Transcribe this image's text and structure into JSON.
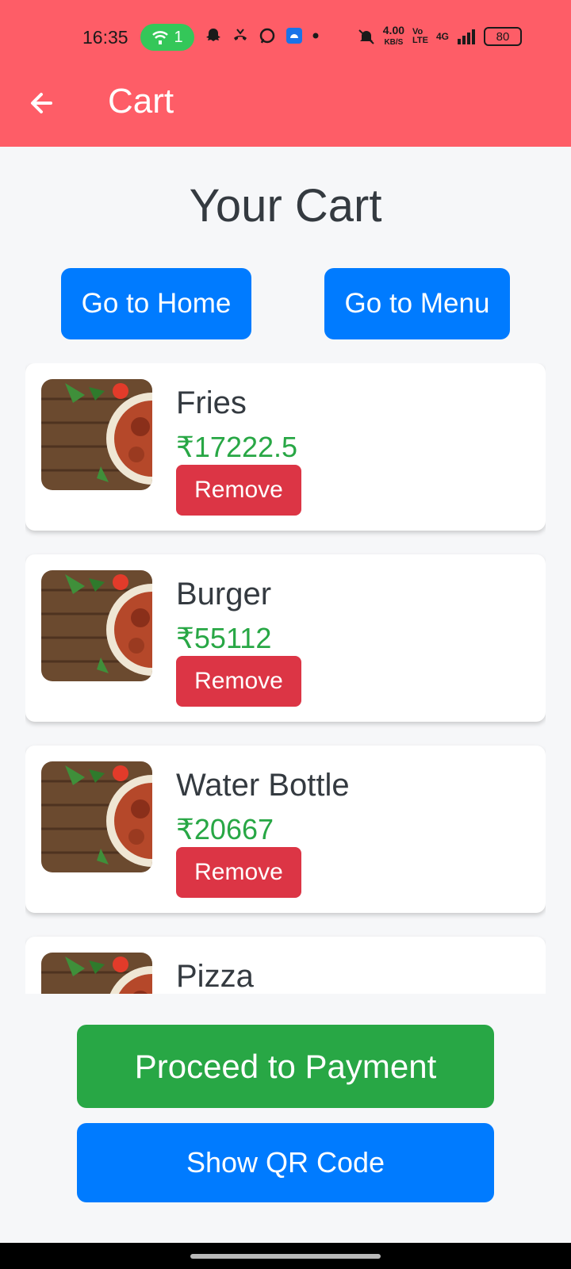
{
  "status_bar": {
    "time": "16:35",
    "wifi_badge": "1",
    "speed": "4.00",
    "speed_unit": "KB/S",
    "network": "4G",
    "battery": "80"
  },
  "app_bar": {
    "title": "Cart",
    "back_icon": "arrow-left-icon"
  },
  "page": {
    "heading": "Your Cart",
    "home_button": "Go to Home",
    "menu_button": "Go to Menu"
  },
  "cart_items": [
    {
      "name": "Fries",
      "price": "₹17222.5",
      "remove_label": "Remove"
    },
    {
      "name": "Burger",
      "price": "₹55112",
      "remove_label": "Remove"
    },
    {
      "name": "Water Bottle",
      "price": "₹20667",
      "remove_label": "Remove"
    },
    {
      "name": "Pizza",
      "price": "",
      "remove_label": ""
    }
  ],
  "actions": {
    "pay_button": "Proceed to Payment",
    "qr_button": "Show QR Code"
  },
  "colors": {
    "app_bar": "#fe5d67",
    "primary": "#007bff",
    "success": "#28a745",
    "danger": "#dc3545"
  }
}
